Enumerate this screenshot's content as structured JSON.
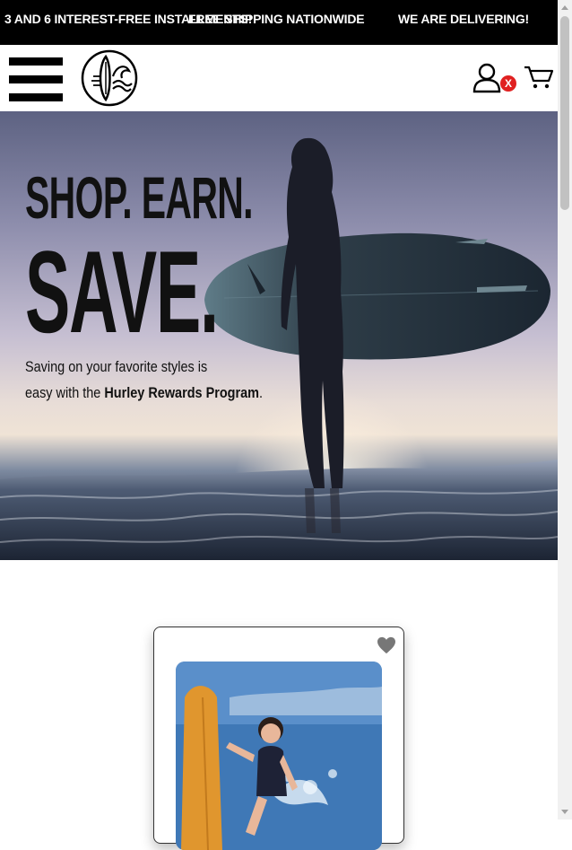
{
  "announcement": {
    "messages": [
      "3 AND 6 INTEREST-FREE INSTALLMENTS!",
      "FREE SHIPPING NATIONWIDE",
      "WE ARE DELIVERING!"
    ]
  },
  "header": {
    "menu_icon": "hamburger-menu-icon",
    "logo_icon": "surfboard-wave-logo-icon",
    "account_icon": "user-icon",
    "account_badge": "X",
    "cart_icon": "shopping-cart-icon"
  },
  "hero": {
    "title_line1": "SHOP. EARN.",
    "title_line2": "SAVE.",
    "copy_line1": "Saving on your favorite styles is",
    "copy_line2_prefix": "easy with the ",
    "copy_line2_bold": "Hurley Rewards Program",
    "copy_line2_suffix": "."
  },
  "product_card": {
    "wishlist_icon": "heart-icon"
  },
  "colors": {
    "announcement_bg": "#000000",
    "badge_red": "#e02020",
    "text_dark": "#111111"
  }
}
